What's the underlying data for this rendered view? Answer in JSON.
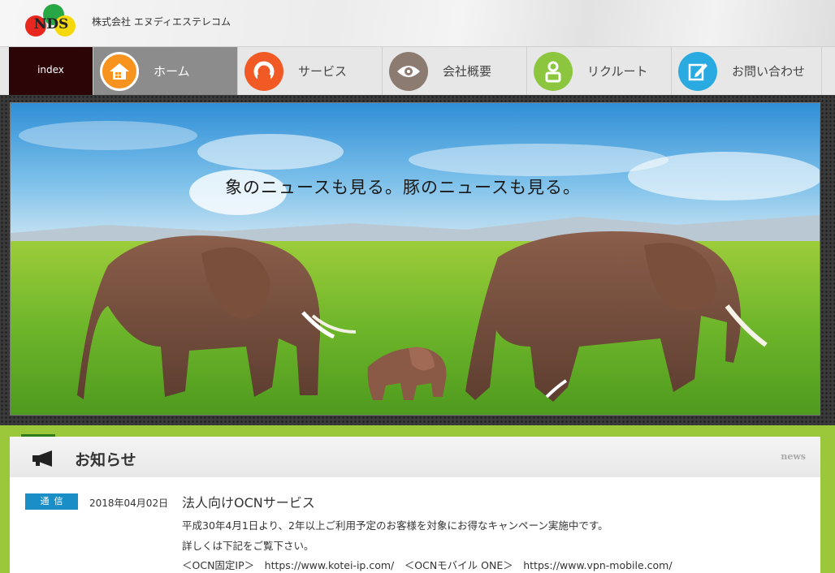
{
  "header": {
    "logo_text": "NDS",
    "company_name": "株式会社 エヌディエステレコム"
  },
  "nav": {
    "index_label": "index",
    "items": [
      {
        "label": "ホーム",
        "icon": "home-icon",
        "color": "#f7931e",
        "active": true
      },
      {
        "label": "サービス",
        "icon": "service-icon",
        "color": "#f15a24",
        "active": false
      },
      {
        "label": "会社概要",
        "icon": "eye-icon",
        "color": "#8c7b70",
        "active": false
      },
      {
        "label": "リクルート",
        "icon": "person-icon",
        "color": "#8cc63f",
        "active": false
      },
      {
        "label": "お問い合わせ",
        "icon": "edit-icon",
        "color": "#29abe2",
        "active": false
      }
    ]
  },
  "hero": {
    "caption": "象のニュースも見る。豚のニュースも見る。"
  },
  "news": {
    "title": "お知らせ",
    "tag": "news",
    "entries": [
      {
        "badge": "通信",
        "date": "2018年04月02日",
        "title": "法人向けOCNサービス",
        "lines": [
          "平成30年4月1日より、2年以上ご利用予定のお客様を対象にお得なキャンペーン実施中です。",
          "詳しくは下記をご覧下さい。",
          "＜OCN固定IP＞　https://www.kotei-ip.com/　＜OCNモバイル ONE＞　https://www.vpn-mobile.com/"
        ]
      }
    ]
  },
  "colors": {
    "accent_green": "#9bc83a",
    "nav_active": "#8c8c8c",
    "index_bg": "#2c0606",
    "badge_blue": "#1a8fc7"
  }
}
